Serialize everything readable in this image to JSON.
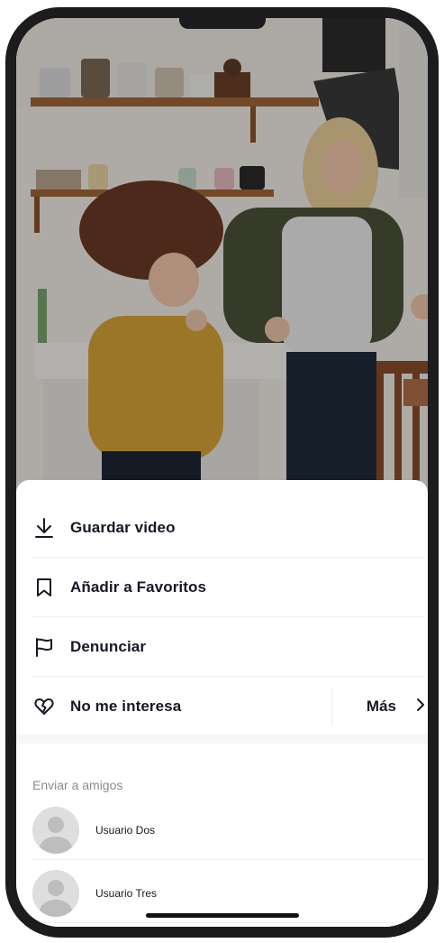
{
  "menu": {
    "save_video": "Guardar video",
    "add_favorites": "Añadir a Favoritos",
    "report": "Denunciar",
    "not_interested": "No me interesa",
    "more": "Más"
  },
  "icons": {
    "save": "download-icon",
    "favorites": "bookmark-icon",
    "report": "flag-icon",
    "not_interested": "broken-heart-icon",
    "more": "chevron-right-icon"
  },
  "share": {
    "title": "Enviar a amigos",
    "friends": [
      {
        "name": "Usuario Dos"
      },
      {
        "name": "Usuario Tres"
      }
    ]
  },
  "colors": {
    "text": "#161823",
    "muted": "#8a8b91",
    "sheet_bg": "#ffffff"
  }
}
